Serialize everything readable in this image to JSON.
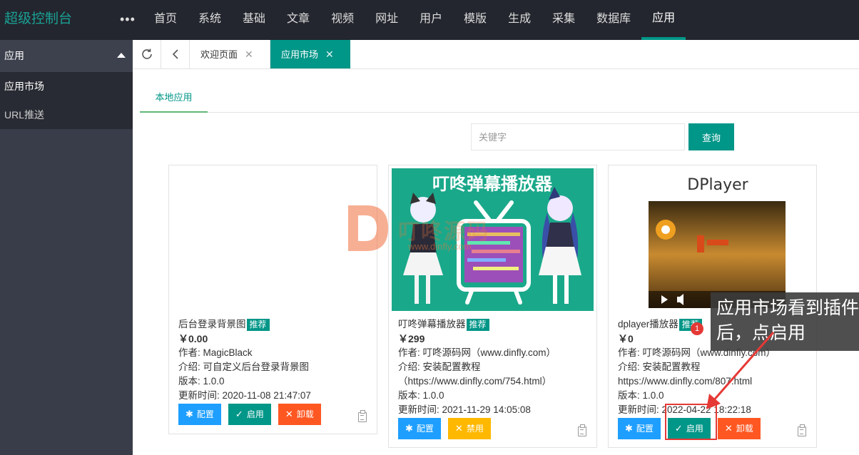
{
  "app": {
    "brand": "超级控制台",
    "more": "•••"
  },
  "topnav": [
    {
      "label": "首页"
    },
    {
      "label": "系统"
    },
    {
      "label": "基础"
    },
    {
      "label": "文章"
    },
    {
      "label": "视频"
    },
    {
      "label": "网址"
    },
    {
      "label": "用户"
    },
    {
      "label": "模版"
    },
    {
      "label": "生成"
    },
    {
      "label": "采集"
    },
    {
      "label": "数据库"
    },
    {
      "label": "应用"
    }
  ],
  "topnav_active": "应用",
  "sidebar": {
    "header": "应用",
    "items": [
      {
        "label": "应用市场"
      },
      {
        "label": "URL推送"
      }
    ]
  },
  "tabs": [
    {
      "label": "欢迎页面",
      "close": "✕"
    },
    {
      "label": "应用市场",
      "close": "✕"
    }
  ],
  "subtabs": [
    {
      "label": "本地应用"
    }
  ],
  "search": {
    "placeholder": "关键字",
    "button": "查询"
  },
  "cards": [
    {
      "title": "后台登录背景图",
      "badge": "推荐",
      "price": "￥0.00",
      "author": "作者: MagicBlack",
      "intro": "介绍: 可自定义后台登录背景图",
      "version": "版本: 1.0.0",
      "updated": "更新时间: 2020-11-08 21:47:07",
      "buttons": [
        {
          "label": "配置",
          "icon": "gear-icon"
        },
        {
          "label": "启用",
          "icon": "check-icon"
        },
        {
          "label": "卸载",
          "icon": "close-icon"
        }
      ]
    },
    {
      "title": "叮咚弹幕播放器",
      "badge": "推荐",
      "price": "￥299",
      "author": "作者: 叮咚源码网（www.dinfly.com）",
      "intro": "介绍: 安装配置教程",
      "intro2": "（https://www.dinfly.com/754.html）",
      "version": "版本: 1.0.0",
      "updated": "更新时间: 2021-11-29 14:05:08",
      "image_title": "叮咚弹幕播放器",
      "buttons": [
        {
          "label": "配置",
          "icon": "gear-icon"
        },
        {
          "label": "禁用",
          "icon": "close-icon"
        }
      ]
    },
    {
      "title": "dplayer播放器",
      "badge": "推荐",
      "price": "￥0",
      "author": "作者: 叮咚源码网（www.dinfly.com）",
      "intro": "介绍: 安装配置教程",
      "intro2": "https://www.dinfly.com/807.html",
      "version": "版本: 1.0.0",
      "updated": "更新时间: 2022-04-22 18:22:18",
      "image_title": "DPlayer",
      "buttons": [
        {
          "label": "配置",
          "icon": "gear-icon"
        },
        {
          "label": "启用",
          "icon": "check-icon"
        },
        {
          "label": "卸载",
          "icon": "close-icon"
        }
      ]
    }
  ],
  "watermark": {
    "text": "叮咚源码",
    "url": "www.dinfly.com"
  },
  "annotation": {
    "text": "应用市场看到插件后，点启用",
    "number": "1"
  },
  "colors": {
    "accent": "#009688",
    "topbar": "#23262e",
    "sidebar": "#393d49",
    "blue": "#1e9fff",
    "orange": "#ff5722",
    "yellow": "#ffb800",
    "annot_red": "#e53935"
  }
}
